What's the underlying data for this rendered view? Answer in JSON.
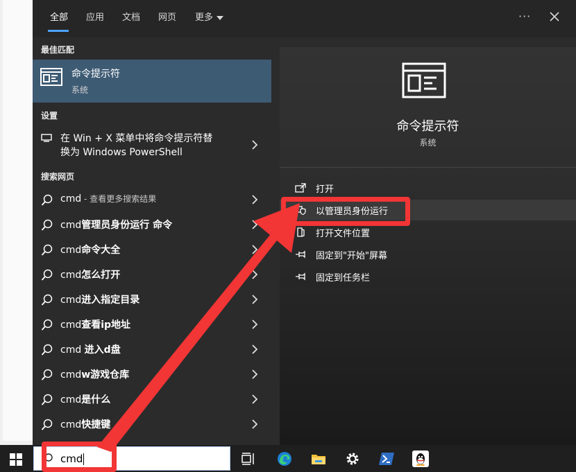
{
  "tabs": [
    {
      "label": "全部",
      "active": true
    },
    {
      "label": "应用"
    },
    {
      "label": "文档"
    },
    {
      "label": "网页"
    },
    {
      "label": "更多"
    }
  ],
  "ellipsis": "···",
  "sections": {
    "best": "最佳匹配",
    "settings": "设置",
    "web": "搜索网页"
  },
  "best_match": {
    "name": "命令提示符",
    "type": "系统"
  },
  "setting_item": {
    "line1": "在 Win + X 菜单中将命令提示符替",
    "line2": "换为 Windows PowerShell"
  },
  "web_results": [
    {
      "text": "cmd",
      "suffix": " - 查看更多搜索结果"
    },
    {
      "text": "cmd",
      "bold": "管理员身份运行 命令"
    },
    {
      "text": "cmd",
      "bold": "命令大全"
    },
    {
      "text": "cmd",
      "bold": "怎么打开"
    },
    {
      "text": "cmd",
      "bold": "进入指定目录"
    },
    {
      "text": "cmd",
      "bold": "查看ip地址"
    },
    {
      "text": "cmd ",
      "bold": "进入d盘"
    },
    {
      "text": "cmd",
      "bold": "w游戏仓库"
    },
    {
      "text": "cmd",
      "bold": "是什么"
    },
    {
      "text": "cmd",
      "bold": "快捷键"
    }
  ],
  "preview": {
    "name": "命令提示符",
    "type": "系统"
  },
  "actions": [
    {
      "label": "打开",
      "icon": "open-icon"
    },
    {
      "label": "以管理员身份运行",
      "icon": "shield-icon"
    },
    {
      "label": "打开文件位置",
      "icon": "folder-icon"
    },
    {
      "label": "固定到\"开始\"屏幕",
      "icon": "pin-icon"
    },
    {
      "label": "固定到任务栏",
      "icon": "pin-icon"
    }
  ],
  "search": {
    "value": "cmd"
  },
  "taskbar_icons": [
    "task-view-icon",
    "edge-icon",
    "file-explorer-icon",
    "settings-icon",
    "powershell-icon",
    "qq-icon"
  ],
  "colors": {
    "accent": "#4da3ff",
    "selection": "#3e5b74",
    "highlight_red": "#f23535"
  }
}
